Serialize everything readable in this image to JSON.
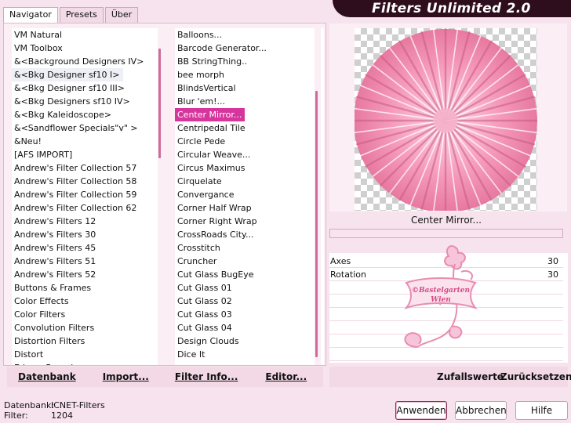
{
  "window": {
    "title": "Filters Unlimited 2.0"
  },
  "tabs": [
    {
      "label": "Navigator",
      "active": true
    },
    {
      "label": "Presets",
      "active": false
    },
    {
      "label": "Über",
      "active": false
    }
  ],
  "categories": [
    "VM Natural",
    "VM Toolbox",
    "&<Background Designers IV>",
    "&<Bkg Designer sf10 I>",
    "&<Bkg Designer sf10 III>",
    "&<Bkg Designers sf10 IV>",
    "&<Bkg Kaleidoscope>",
    "&<Sandflower Specials\"v\" >",
    "&Neu!",
    "[AFS IMPORT]",
    "Andrew's Filter Collection 57",
    "Andrew's Filter Collection 58",
    "Andrew's Filter Collection 59",
    "Andrew's Filter Collection 62",
    "Andrew's Filters 12",
    "Andrew's Filters 30",
    "Andrew's Filters 45",
    "Andrew's Filters 51",
    "Andrew's Filters 52",
    "Buttons & Frames",
    "Color Effects",
    "Color Filters",
    "Convolution Filters",
    "Distortion Filters",
    "Distort",
    "Edges, Round"
  ],
  "categories_selected_index": 3,
  "filters": [
    "Balloons...",
    "Barcode Generator...",
    "BB StringThing..",
    "bee morph",
    "BlindsVertical",
    "Blur 'em!...",
    "Center Mirror...",
    "Centripedal Tile",
    "Circle Pede",
    "Circular Weave...",
    "Circus Maximus",
    "Cirquelate",
    "Convergance",
    "Corner Half Wrap",
    "Corner Right Wrap",
    "CrossRoads City...",
    "Crosstitch",
    "Cruncher",
    "Cut Glass  BugEye",
    "Cut Glass 01",
    "Cut Glass 02",
    "Cut Glass 03",
    "Cut Glass 04",
    "Design Clouds",
    "Dice It"
  ],
  "filters_selected_index": 6,
  "filters_marked_index": 23,
  "bottom_left_buttons": {
    "database": "Datenbank",
    "import": "Import...",
    "filter_info": "Filter Info...",
    "editor": "Editor..."
  },
  "preview": {
    "filter_name": "Center Mirror...",
    "progress": 0
  },
  "watermark": {
    "text": "©Bastelgarten Wien"
  },
  "params": [
    {
      "label": "Axes",
      "value": "30"
    },
    {
      "label": "Rotation",
      "value": "30"
    }
  ],
  "bottom_right_buttons": {
    "random": "Zufallswerte",
    "reset": "Zurücksetzen"
  },
  "status": {
    "database_label": "Datenbank:",
    "database_value": "ICNET-Filters",
    "filter_label": "Filter:",
    "filter_value": "1204"
  },
  "dialog_buttons": {
    "apply": "Anwenden",
    "cancel": "Abbrechen",
    "help": "Hilfe"
  },
  "colors": {
    "accent": "#d6359c",
    "title_bar": "#2e0d1c",
    "background": "#f7e3ee",
    "preview_pink": "#f08fb2"
  }
}
